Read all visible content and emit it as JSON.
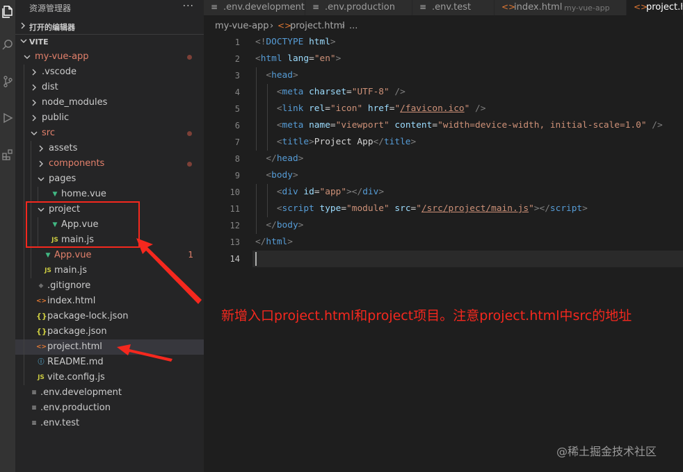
{
  "sidebar": {
    "title": "资源管理器",
    "more": "···",
    "sections": {
      "open_editors": "打开的编辑器",
      "workspace": "VITE"
    },
    "items": [
      {
        "label": "my-vue-app",
        "depth": 0,
        "kind": "folder",
        "open": true,
        "icon": "none",
        "modified": true,
        "dot": true
      },
      {
        "label": ".vscode",
        "depth": 1,
        "kind": "folder",
        "open": false,
        "icon": "none"
      },
      {
        "label": "dist",
        "depth": 1,
        "kind": "folder",
        "open": false,
        "icon": "none"
      },
      {
        "label": "node_modules",
        "depth": 1,
        "kind": "folder",
        "open": false,
        "icon": "none"
      },
      {
        "label": "public",
        "depth": 1,
        "kind": "folder",
        "open": false,
        "icon": "none"
      },
      {
        "label": "src",
        "depth": 1,
        "kind": "folder",
        "open": true,
        "icon": "none",
        "modified": true,
        "dot": true
      },
      {
        "label": "assets",
        "depth": 2,
        "kind": "folder",
        "open": false,
        "icon": "none"
      },
      {
        "label": "components",
        "depth": 2,
        "kind": "folder",
        "open": false,
        "icon": "none",
        "modified": true,
        "dot": true
      },
      {
        "label": "pages",
        "depth": 2,
        "kind": "folder",
        "open": true,
        "icon": "none"
      },
      {
        "label": "home.vue",
        "depth": 3,
        "kind": "file",
        "icon": "vue-icon"
      },
      {
        "label": "project",
        "depth": 2,
        "kind": "folder",
        "open": true,
        "icon": "none"
      },
      {
        "label": "App.vue",
        "depth": 3,
        "kind": "file",
        "icon": "vue-icon"
      },
      {
        "label": "main.js",
        "depth": 3,
        "kind": "file",
        "icon": "js-icon"
      },
      {
        "label": "App.vue",
        "depth": 2,
        "kind": "file",
        "icon": "vue-icon",
        "modified": true,
        "badge": "1"
      },
      {
        "label": "main.js",
        "depth": 2,
        "kind": "file",
        "icon": "js-icon"
      },
      {
        "label": ".gitignore",
        "depth": 1,
        "kind": "file",
        "icon": "git-icon"
      },
      {
        "label": "index.html",
        "depth": 1,
        "kind": "file",
        "icon": "html-icon"
      },
      {
        "label": "package-lock.json",
        "depth": 1,
        "kind": "file",
        "icon": "json-icon"
      },
      {
        "label": "package.json",
        "depth": 1,
        "kind": "file",
        "icon": "json-icon"
      },
      {
        "label": "project.html",
        "depth": 1,
        "kind": "file",
        "icon": "html-icon",
        "selected": true
      },
      {
        "label": "README.md",
        "depth": 1,
        "kind": "file",
        "icon": "info-icon"
      },
      {
        "label": "vite.config.js",
        "depth": 1,
        "kind": "file",
        "icon": "js-icon"
      },
      {
        "label": ".env.development",
        "depth": 0,
        "kind": "file",
        "icon": "lines-icon"
      },
      {
        "label": ".env.production",
        "depth": 0,
        "kind": "file",
        "icon": "lines-icon"
      },
      {
        "label": ".env.test",
        "depth": 0,
        "kind": "file",
        "icon": "lines-icon"
      }
    ]
  },
  "tabs": [
    {
      "label": ".env.development",
      "icon": "lines-icon",
      "desc": ""
    },
    {
      "label": ".env.production",
      "icon": "lines-icon",
      "desc": ""
    },
    {
      "label": ".env.test",
      "icon": "lines-icon",
      "desc": ""
    },
    {
      "label": "index.html",
      "icon": "html-icon",
      "desc": "my-vue-app"
    },
    {
      "label": "project.html",
      "icon": "html-icon",
      "desc": "",
      "active": true
    }
  ],
  "breadcrumb": {
    "folder": "my-vue-app",
    "file": "project.html",
    "tail": "..."
  },
  "editor": {
    "current_line": 14,
    "lines": [
      [
        [
          "<!",
          "punc"
        ],
        [
          "DOCTYPE",
          "tag"
        ],
        [
          " ",
          "text"
        ],
        [
          "html",
          "attr"
        ],
        [
          ">",
          "punc"
        ]
      ],
      [
        [
          "<",
          "punc"
        ],
        [
          "html",
          "tag"
        ],
        [
          " ",
          "text"
        ],
        [
          "lang",
          "attr"
        ],
        [
          "=",
          "text"
        ],
        [
          "\"en\"",
          "str"
        ],
        [
          ">",
          "punc"
        ]
      ],
      [
        [
          "  ",
          "text"
        ],
        [
          "<",
          "punc"
        ],
        [
          "head",
          "tag"
        ],
        [
          ">",
          "punc"
        ]
      ],
      [
        [
          "    ",
          "text"
        ],
        [
          "<",
          "punc"
        ],
        [
          "meta",
          "tag"
        ],
        [
          " ",
          "text"
        ],
        [
          "charset",
          "attr"
        ],
        [
          "=",
          "text"
        ],
        [
          "\"UTF-8\"",
          "str"
        ],
        [
          " />",
          "punc"
        ]
      ],
      [
        [
          "    ",
          "text"
        ],
        [
          "<",
          "punc"
        ],
        [
          "link",
          "tag"
        ],
        [
          " ",
          "text"
        ],
        [
          "rel",
          "attr"
        ],
        [
          "=",
          "text"
        ],
        [
          "\"icon\"",
          "str"
        ],
        [
          " ",
          "text"
        ],
        [
          "href",
          "attr"
        ],
        [
          "=",
          "text"
        ],
        [
          "\"",
          "str"
        ],
        [
          "/favicon.ico",
          "link"
        ],
        [
          "\"",
          "str"
        ],
        [
          " />",
          "punc"
        ]
      ],
      [
        [
          "    ",
          "text"
        ],
        [
          "<",
          "punc"
        ],
        [
          "meta",
          "tag"
        ],
        [
          " ",
          "text"
        ],
        [
          "name",
          "attr"
        ],
        [
          "=",
          "text"
        ],
        [
          "\"viewport\"",
          "str"
        ],
        [
          " ",
          "text"
        ],
        [
          "content",
          "attr"
        ],
        [
          "=",
          "text"
        ],
        [
          "\"width=device-width, initial-scale=1.0\"",
          "str"
        ],
        [
          " />",
          "punc"
        ]
      ],
      [
        [
          "    ",
          "text"
        ],
        [
          "<",
          "punc"
        ],
        [
          "title",
          "tag"
        ],
        [
          ">",
          "punc"
        ],
        [
          "Project App",
          "text"
        ],
        [
          "</",
          "punc"
        ],
        [
          "title",
          "tag"
        ],
        [
          ">",
          "punc"
        ]
      ],
      [
        [
          "  ",
          "text"
        ],
        [
          "</",
          "punc"
        ],
        [
          "head",
          "tag"
        ],
        [
          ">",
          "punc"
        ]
      ],
      [
        [
          "  ",
          "text"
        ],
        [
          "<",
          "punc"
        ],
        [
          "body",
          "tag"
        ],
        [
          ">",
          "punc"
        ]
      ],
      [
        [
          "    ",
          "text"
        ],
        [
          "<",
          "punc"
        ],
        [
          "div",
          "tag"
        ],
        [
          " ",
          "text"
        ],
        [
          "id",
          "attr"
        ],
        [
          "=",
          "text"
        ],
        [
          "\"app\"",
          "str"
        ],
        [
          "></",
          "punc"
        ],
        [
          "div",
          "tag"
        ],
        [
          ">",
          "punc"
        ]
      ],
      [
        [
          "    ",
          "text"
        ],
        [
          "<",
          "punc"
        ],
        [
          "script",
          "tag"
        ],
        [
          " ",
          "text"
        ],
        [
          "type",
          "attr"
        ],
        [
          "=",
          "text"
        ],
        [
          "\"module\"",
          "str"
        ],
        [
          " ",
          "text"
        ],
        [
          "src",
          "attr"
        ],
        [
          "=",
          "text"
        ],
        [
          "\"",
          "str"
        ],
        [
          "/src/project/main.js",
          "link"
        ],
        [
          "\"",
          "str"
        ],
        [
          "></",
          "punc"
        ],
        [
          "script",
          "tag"
        ],
        [
          ">",
          "punc"
        ]
      ],
      [
        [
          "  ",
          "text"
        ],
        [
          "</",
          "punc"
        ],
        [
          "body",
          "tag"
        ],
        [
          ">",
          "punc"
        ]
      ],
      [
        [
          "</",
          "punc"
        ],
        [
          "html",
          "tag"
        ],
        [
          ">",
          "punc"
        ]
      ],
      []
    ]
  },
  "annotation": {
    "text": "新增入口project.html和project项目。注意project.html中src的地址",
    "color": "#f5281e"
  },
  "watermark": "@稀土掘金技术社区",
  "colors": {
    "modified": "#e2806b",
    "tag": "#569cd6",
    "attr": "#9cdcfe",
    "string": "#ce9178",
    "vue": "#41b883",
    "js": "#cbcb41"
  }
}
